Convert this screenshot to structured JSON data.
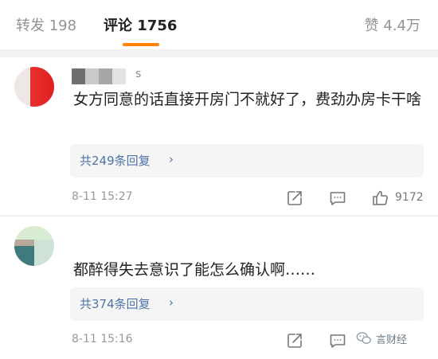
{
  "tabs": {
    "repost": "转发 198",
    "comment": "评论 1756",
    "like": "赞 4.4万"
  },
  "colors": {
    "accent": "#ff8200",
    "link": "#4f74a8",
    "muted": "#999999"
  },
  "comments": [
    {
      "username_tail": "s",
      "text": "女方同意的话直接开房门不就好了，费劲办房卡干啥",
      "reply_label": "共249条回复",
      "reply_chevron": "›",
      "time": "8-11 15:27",
      "icons": [
        "share-icon",
        "comment-icon",
        "like-icon"
      ],
      "likes": "9172"
    },
    {
      "text": "都醉得失去意识了能怎么确认啊……",
      "reply_label": "共374条回复",
      "reply_chevron": "›",
      "time": "8-11 15:16",
      "icons": [
        "share-icon",
        "comment-icon",
        "like-icon"
      ]
    }
  ],
  "watermark": {
    "text": "言财经",
    "icon": "wechat-icon"
  }
}
